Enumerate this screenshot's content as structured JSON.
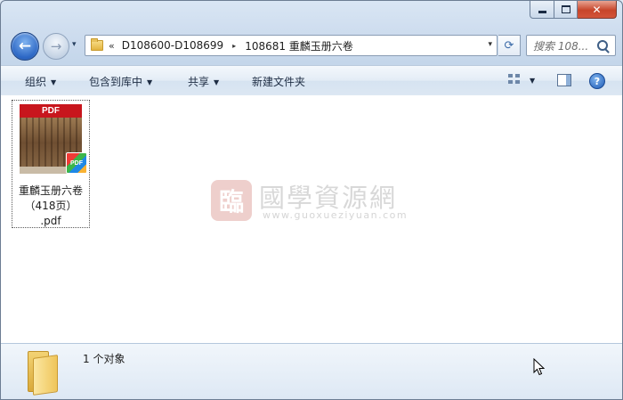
{
  "window": {
    "caption_buttons": {
      "minimize": "min-icon",
      "maximize": "max-icon",
      "close_label": "✕"
    }
  },
  "nav": {
    "back_glyph": "←",
    "forward_glyph": "→",
    "history_dropdown": "▾"
  },
  "address": {
    "overflow": "«",
    "crumbs": [
      "D108600-D108699",
      "108681 重麟玉册六卷"
    ],
    "separator": "▸",
    "dropdown": "▾"
  },
  "refresh_glyph": "⟳",
  "search": {
    "placeholder": "搜索 108..."
  },
  "toolbar": {
    "organize": "组织",
    "include_in_library": "包含到库中",
    "share": "共享",
    "new_folder": "新建文件夹",
    "dropdown": "▼",
    "help": "?"
  },
  "files": [
    {
      "name_line1": "重麟玉册六卷",
      "name_line2": "（418页）",
      "name_line3": ".pdf",
      "thumb_header": "PDF",
      "badge": "PDF"
    }
  ],
  "watermark": {
    "seal": "臨",
    "title": "國學資源網",
    "url": "www.guoxueziyuan.com"
  },
  "details": {
    "count": "1 个对象"
  },
  "colors": {
    "accent_blue": "#2b66c4",
    "close_red": "#c7452a",
    "pdf_red": "#c8161d",
    "folder_yellow": "#efc55a"
  }
}
